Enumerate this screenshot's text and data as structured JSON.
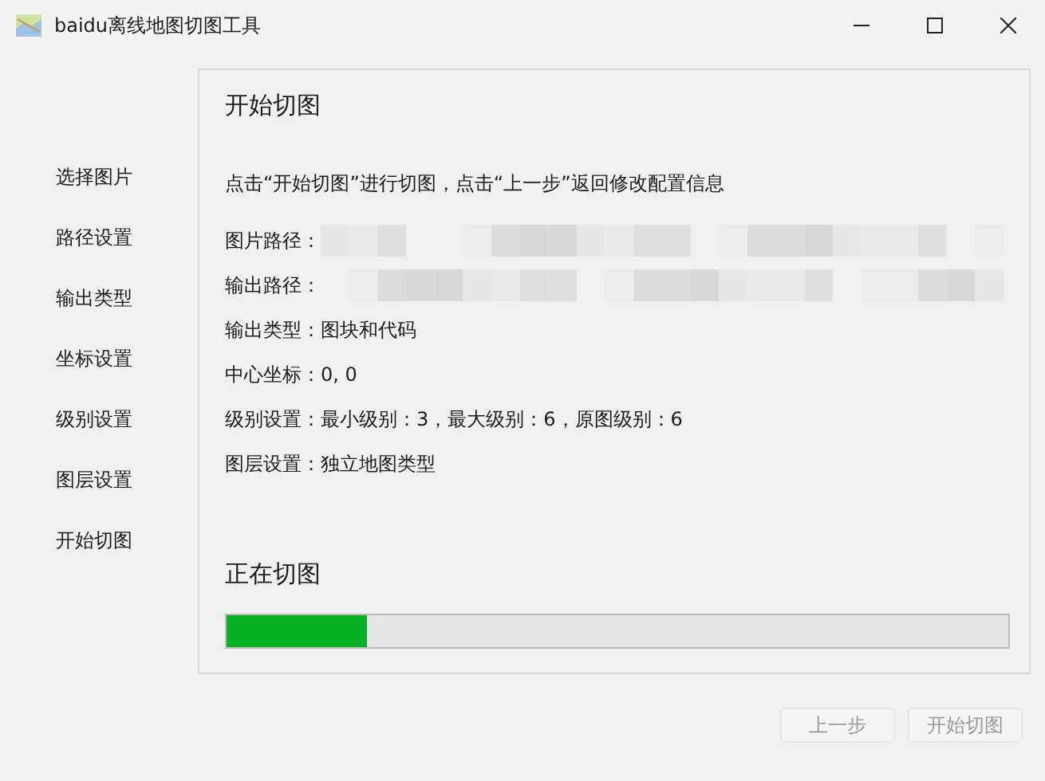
{
  "window": {
    "title": "baidu离线地图切图工具"
  },
  "sidebar": {
    "items": [
      {
        "label": "选择图片"
      },
      {
        "label": "路径设置"
      },
      {
        "label": "输出类型"
      },
      {
        "label": "坐标设置"
      },
      {
        "label": "级别设置"
      },
      {
        "label": "图层设置"
      },
      {
        "label": "开始切图"
      }
    ]
  },
  "panel": {
    "title": "开始切图",
    "instruction": "点击“开始切图”进行切图，点击“上一步”返回修改配置信息",
    "fields": [
      {
        "label": "图片路径：",
        "kind": "redacted"
      },
      {
        "label": "输出路径：",
        "kind": "redacted"
      },
      {
        "label": "输出类型：",
        "kind": "text",
        "value": "图块和代码"
      },
      {
        "label": "中心坐标：",
        "kind": "text",
        "value": "0, 0"
      },
      {
        "label": "级别设置：",
        "kind": "text",
        "value": "最小级别：3，最大级别：6，原图级别：6"
      },
      {
        "label": "图层设置：",
        "kind": "text",
        "value": "独立地图类型"
      }
    ],
    "progress_title": "正在切图",
    "progress": {
      "level": 0.18
    }
  },
  "buttons": [
    {
      "label": "上一步",
      "disabled": true
    },
    {
      "label": "开始切图",
      "disabled": true
    }
  ]
}
